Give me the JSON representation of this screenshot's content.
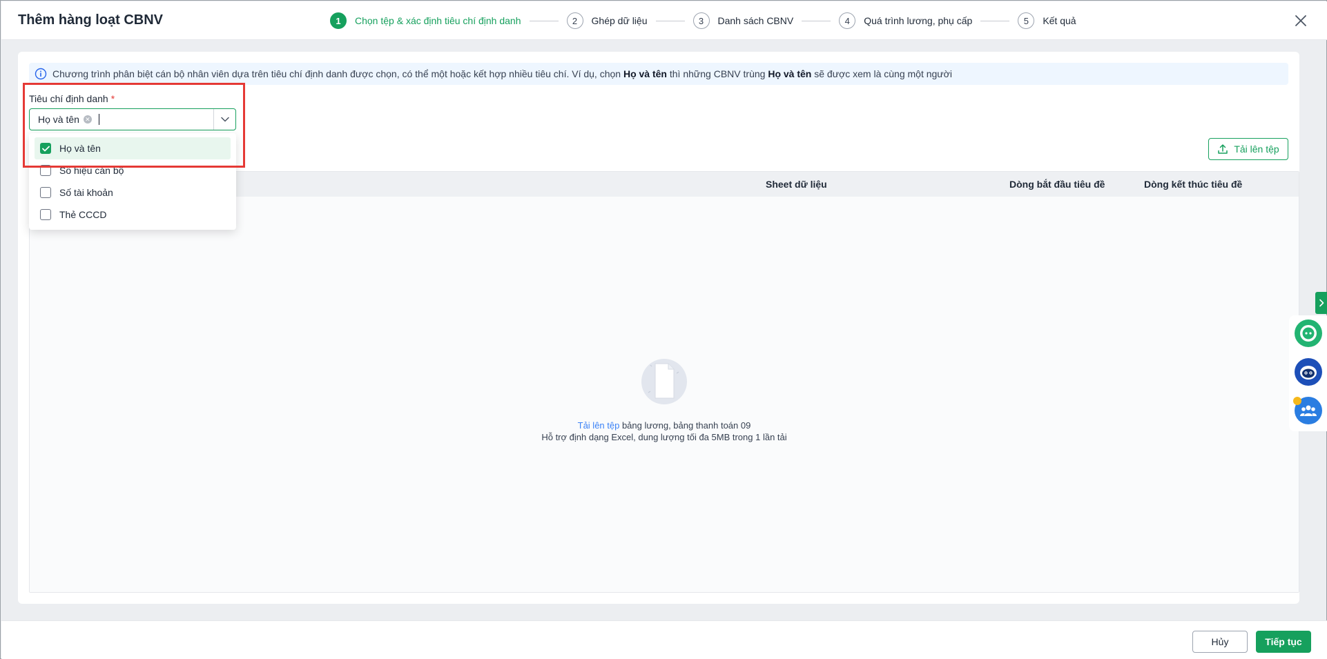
{
  "header": {
    "title": "Thêm hàng loạt CBNV",
    "steps": [
      {
        "num": "1",
        "label": "Chọn tệp & xác định tiêu chí định danh"
      },
      {
        "num": "2",
        "label": "Ghép dữ liệu"
      },
      {
        "num": "3",
        "label": "Danh sách CBNV"
      },
      {
        "num": "4",
        "label": "Quá trình lương, phụ cấp"
      },
      {
        "num": "5",
        "label": "Kết quả"
      }
    ]
  },
  "info": {
    "p1": "Chương trình phân biệt cán bộ nhân viên dựa trên tiêu chí định danh được chọn, có thể một hoặc kết hợp nhiều tiêu chí. Ví dụ, chọn ",
    "b1": "Họ và tên",
    "p2": " thì những CBNV trùng ",
    "b2": "Họ và tên",
    "p3": " sẽ được xem là cùng một người"
  },
  "criteria": {
    "label": "Tiêu chí định danh",
    "required_mark": "*",
    "selected_chip": "Họ và tên",
    "options": [
      {
        "label": "Họ và tên",
        "checked": true
      },
      {
        "label": "Số hiệu cán bộ",
        "checked": false
      },
      {
        "label": "Số tài khoản",
        "checked": false
      },
      {
        "label": "Thẻ CCCD",
        "checked": false
      }
    ]
  },
  "upload_button": "Tải lên tệp",
  "table": {
    "columns": [
      "Sheet dữ liệu",
      "Dòng bắt đầu tiêu đề",
      "Dòng kết thúc tiêu đề"
    ]
  },
  "empty_state": {
    "link": "Tải lên tệp",
    "line1_rest": " bảng lương, bảng thanh toán 09",
    "line2": "Hỗ trợ định dạng Excel, dung lượng tối đa 5MB trong 1 lần tải"
  },
  "footer": {
    "cancel": "Hủy",
    "next": "Tiếp tục"
  },
  "colors": {
    "primary": "#16a05d",
    "highlight": "#e53935",
    "link": "#3b82f6"
  },
  "icons": [
    "info-icon",
    "close-icon",
    "chevron-down-icon",
    "check-icon",
    "upload-icon",
    "document-icon",
    "chevron-right-icon",
    "chat-icon",
    "robot-icon",
    "group-icon"
  ]
}
